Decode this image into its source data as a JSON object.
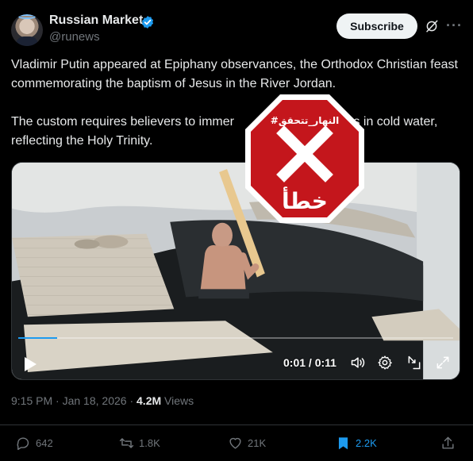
{
  "author": {
    "name": "Russian Market",
    "handle": "@runews",
    "verified": true
  },
  "header": {
    "subscribe_label": "Subscribe"
  },
  "tweet": {
    "paragraph1": "Vladimir Putin appeared at Epiphany observances, the Orthodox Christian feast commemorating the baptism of Jesus in the River Jordan.",
    "paragraph2_before": "The custom requires believers to immer",
    "paragraph2_after": "ee times in cold water, reflecting the Holy Trinity."
  },
  "video": {
    "time_display": "0:01 / 0:11",
    "progress": 0.09
  },
  "stamp": {
    "hashtag": "#النهار_تتحقق",
    "verdict": "خطأ",
    "color": "#c4161c"
  },
  "meta": {
    "time": "9:15 PM",
    "separator": "·",
    "date": "Jan 18, 2026",
    "views_count": "4.2M",
    "views_label": "Views"
  },
  "actions": {
    "replies": "642",
    "reposts": "1.8K",
    "likes": "21K",
    "bookmarks": "2.2K"
  },
  "colors": {
    "accent": "#1d9bf0",
    "muted": "#71767b",
    "background": "#000000"
  }
}
